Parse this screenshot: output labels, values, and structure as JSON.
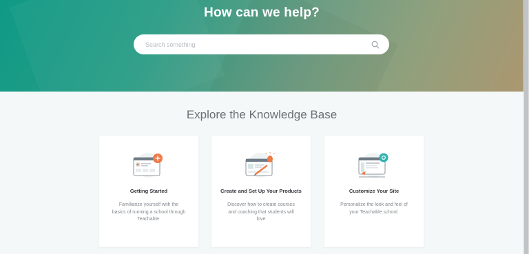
{
  "hero": {
    "title": "How can we help?",
    "search_placeholder": "Search something",
    "search_icon": "search-icon"
  },
  "section": {
    "title": "Explore the Knowledge Base"
  },
  "cards": [
    {
      "title": "Getting Started",
      "description": "Familiarize yourself with the basics of running a school through Teachable.",
      "icon": "getting-started-illustration"
    },
    {
      "title": "Create and Set Up Your Products",
      "description": "Discover how to create courses and coaching that students will love",
      "icon": "products-illustration"
    },
    {
      "title": "Customize Your Site",
      "description": "Personalize the look and feel of your Teachable school.",
      "icon": "customize-site-illustration"
    }
  ],
  "colors": {
    "accent_orange": "#ef7a47",
    "accent_teal": "#2fb3b3"
  }
}
